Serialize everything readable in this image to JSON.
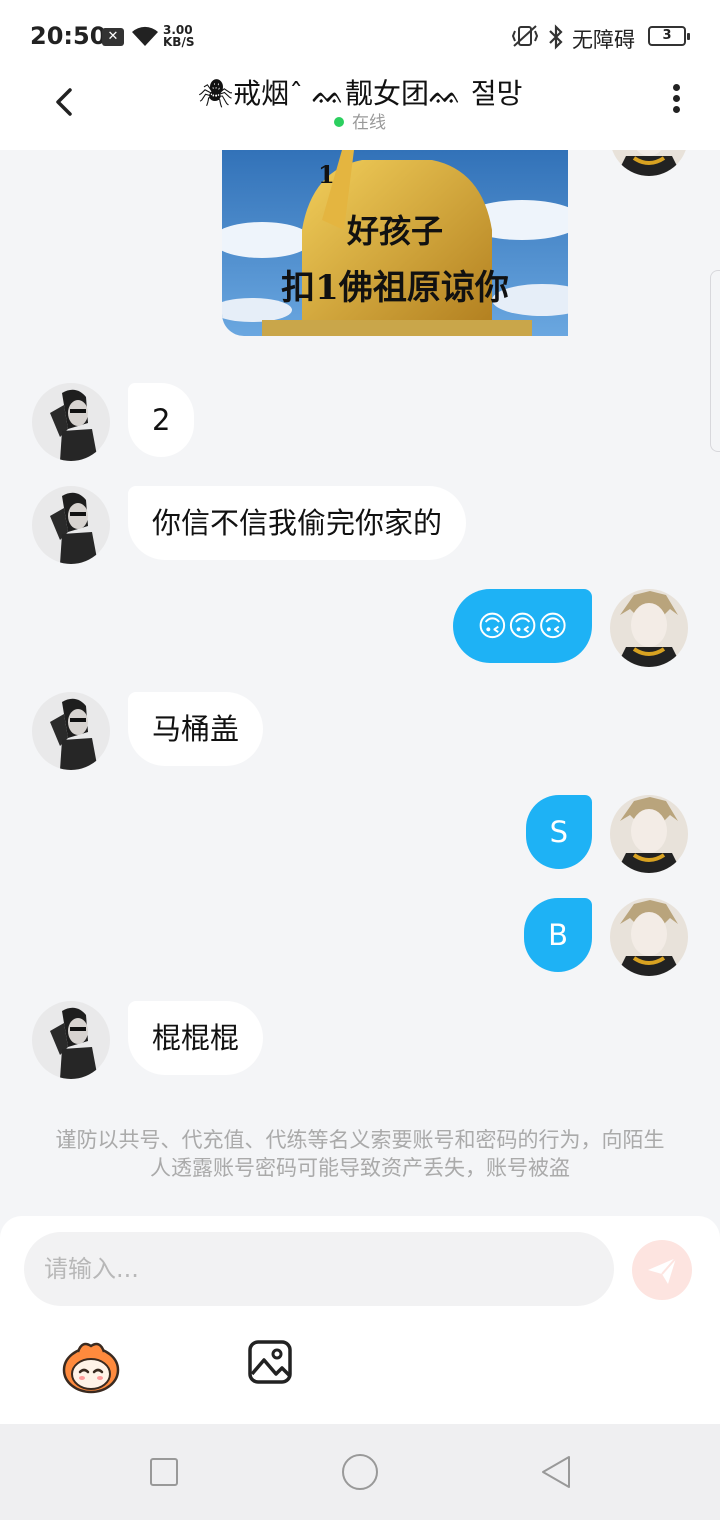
{
  "status_bar": {
    "time": "20:50",
    "network_speed_value": "3.00",
    "network_speed_unit": "KB/S",
    "accessibility_label": "无障碍",
    "battery_level": "3",
    "icons": [
      "notification-x-icon",
      "wifi-icon",
      "vibrate-icon",
      "bluetooth-icon",
      "battery-icon"
    ]
  },
  "header": {
    "title": "🕷戒烟ˆ ᨐ靓女团ᨐ 절망",
    "status": "在线",
    "status_color": "#2ccf5f"
  },
  "image_message": {
    "caption_line1": "好孩子",
    "caption_line2": "扣1佛祖原谅你",
    "number": "1"
  },
  "messages": [
    {
      "sender": "them",
      "text": "2"
    },
    {
      "sender": "them",
      "text": "你信不信我偷完你家的"
    },
    {
      "sender": "me",
      "text": "🙃🙃🙃"
    },
    {
      "sender": "them",
      "text": "马桶盖"
    },
    {
      "sender": "me",
      "text": "S"
    },
    {
      "sender": "me",
      "text": "B"
    },
    {
      "sender": "them",
      "text": "棍棍棍"
    }
  ],
  "warning_text": "谨防以共号、代充值、代练等名义索要账号和密码的行为，向陌生人透露账号密码可能导致资产丢失，账号被盗",
  "composer": {
    "placeholder": "请输入..."
  },
  "colors": {
    "my_bubble": "#1eb2f5",
    "their_bubble": "#ffffff",
    "background": "#f4f5f7",
    "send_button": "#fde4e0"
  }
}
